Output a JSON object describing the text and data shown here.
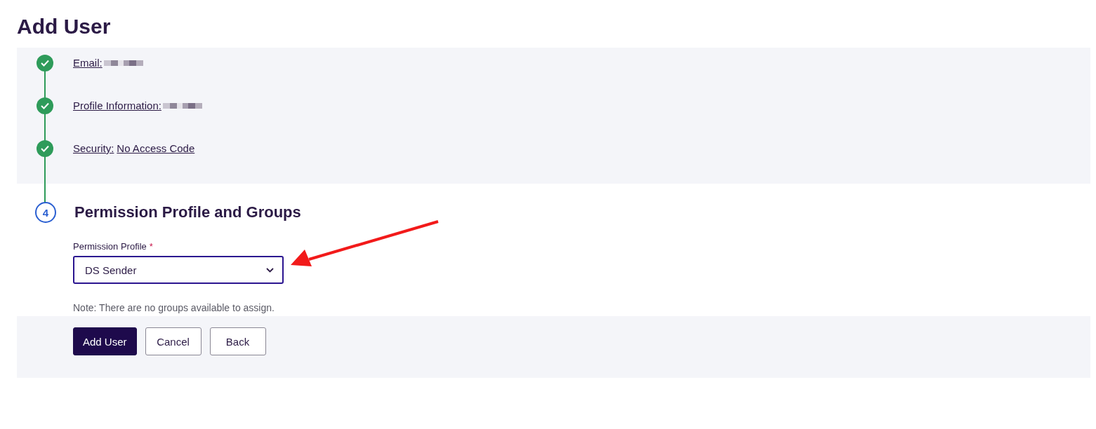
{
  "page_title": "Add User",
  "steps": [
    {
      "label": "Email:",
      "redacted": true,
      "completed": true
    },
    {
      "label": "Profile Information:",
      "redacted": true,
      "completed": true
    },
    {
      "label": "Security:",
      "value": "No Access Code",
      "redacted": false,
      "completed": true
    }
  ],
  "current_step": {
    "number": "4",
    "title": "Permission Profile and Groups"
  },
  "permission_profile": {
    "label": "Permission Profile",
    "required_mark": "*",
    "value": "DS Sender"
  },
  "note": "Note: There are no groups available to assign.",
  "buttons": [
    {
      "label": "Add User",
      "kind": "primary"
    },
    {
      "label": "Cancel",
      "kind": "secondary"
    },
    {
      "label": "Back",
      "kind": "secondary"
    }
  ]
}
